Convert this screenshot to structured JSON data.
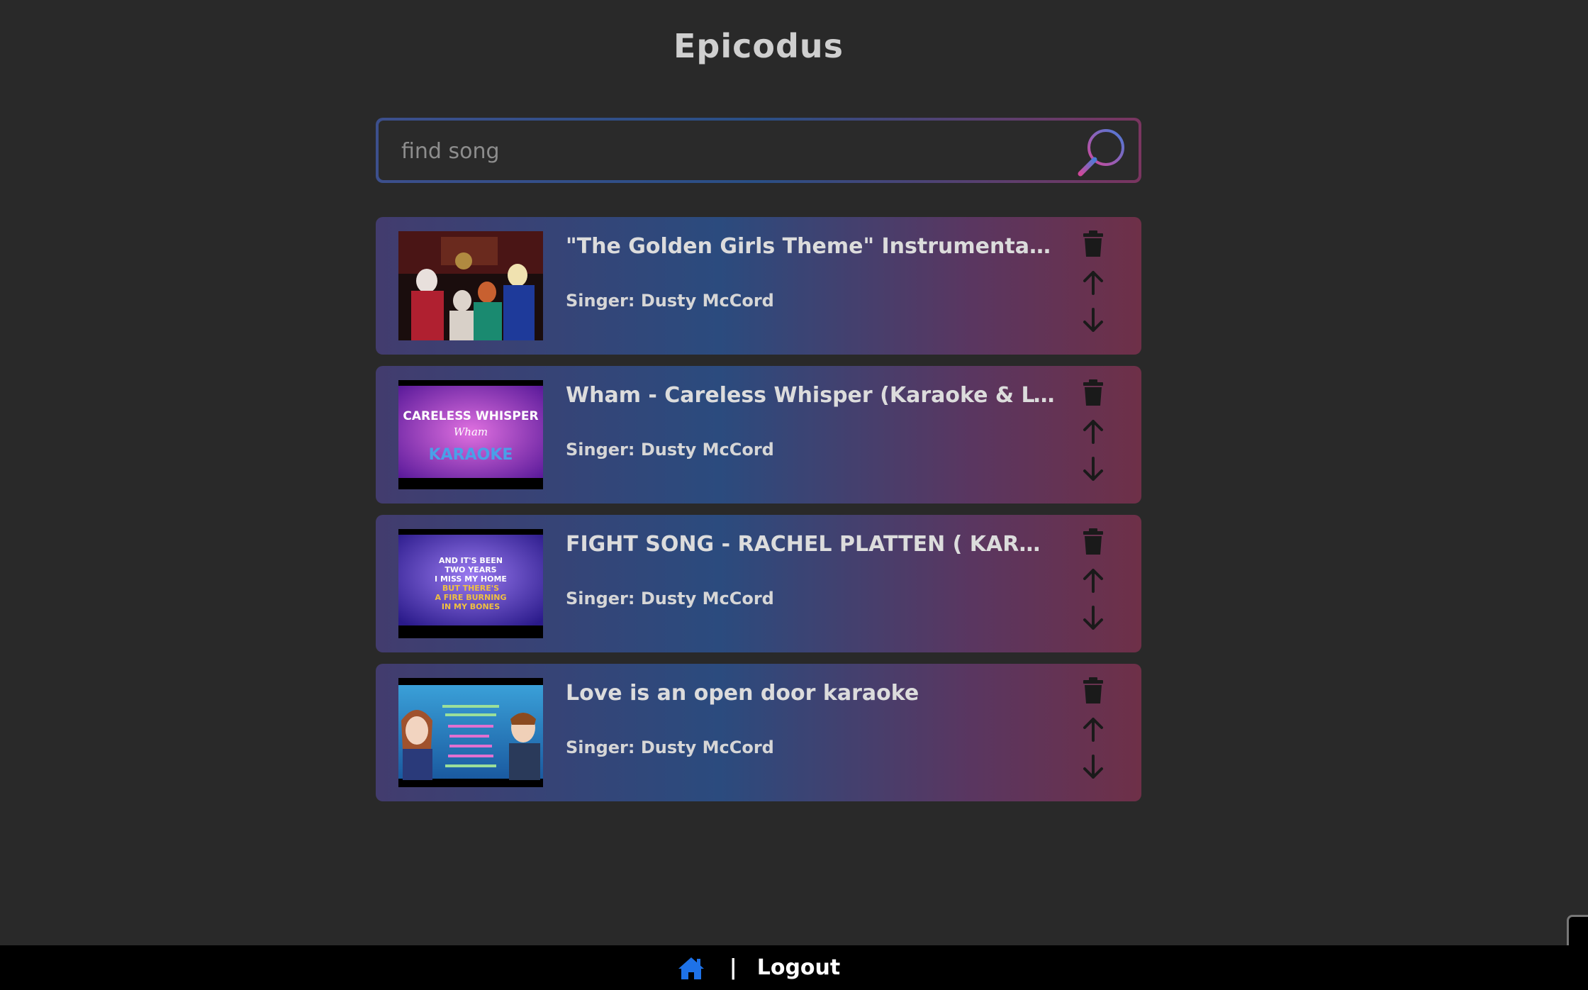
{
  "app": {
    "title": "Epicodus"
  },
  "search": {
    "placeholder": "find song",
    "value": ""
  },
  "colors": {
    "background": "#292929",
    "card_gradient_start": "#423c6e",
    "card_gradient_mid": "#2b4b7e",
    "card_gradient_end": "#6e3048",
    "home_icon": "#1e72e8"
  },
  "songs": [
    {
      "title": "\"The Golden Girls Theme\" Instrumental Version",
      "singer": "Singer: Dusty McCord",
      "thumbnail": "golden-girls-thumbnail"
    },
    {
      "title": "Wham - Careless Whisper (Karaoke & Lyrics)",
      "singer": "Singer: Dusty McCord",
      "thumbnail": "careless-whisper-thumbnail",
      "thumb_text_1": "CARELESS WHISPER",
      "thumb_text_2": "Wham",
      "thumb_text_3": "KARAOKE"
    },
    {
      "title": "FIGHT SONG - RACHEL PLATTEN ( KARAOKE )",
      "singer": "Singer: Dusty McCord",
      "thumbnail": "fight-song-thumbnail",
      "thumb_lines": [
        "AND IT'S BEEN",
        "TWO YEARS",
        "I MISS MY HOME",
        "BUT THERE'S",
        "A FIRE BURNING",
        "IN MY BONES"
      ]
    },
    {
      "title": "Love is an open door karaoke",
      "singer": "Singer: Dusty McCord",
      "thumbnail": "love-open-door-thumbnail"
    }
  ],
  "actions": {
    "delete_icon": "trash-icon",
    "up_icon": "arrow-up-icon",
    "down_icon": "arrow-down-icon"
  },
  "footer": {
    "home_icon": "home-icon",
    "separator": "|",
    "logout_label": "Logout"
  }
}
